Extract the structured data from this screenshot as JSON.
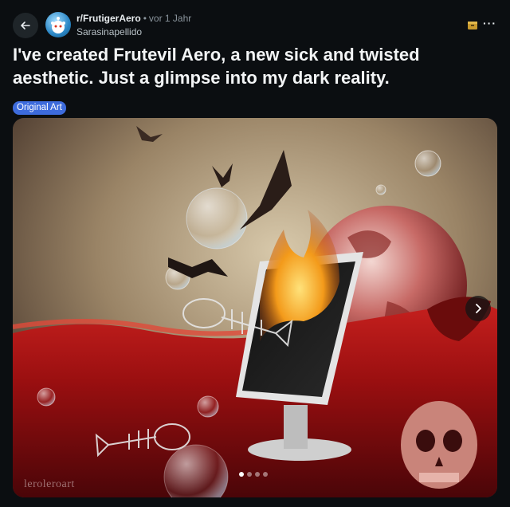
{
  "header": {
    "subreddit": "r/FrutigerAero",
    "separator": "•",
    "time": "vor 1 Jahr",
    "username": "Sarasinapellido",
    "back_icon": "arrow-left-icon",
    "avatar_icon": "subreddit-avatar",
    "save_icon": "save-icon",
    "more_icon": "more-horizontal-icon",
    "more_label": "···"
  },
  "post": {
    "title": "I've created Frutevil Aero, a new sick and twisted aesthetic. Just a glimpse into my dark reality.",
    "flair": "Original Art",
    "flair_color": "#3d6bdc"
  },
  "gallery": {
    "watermark": "leroleroart",
    "current_index": 1,
    "total": 4,
    "next_icon": "chevron-right-icon"
  }
}
